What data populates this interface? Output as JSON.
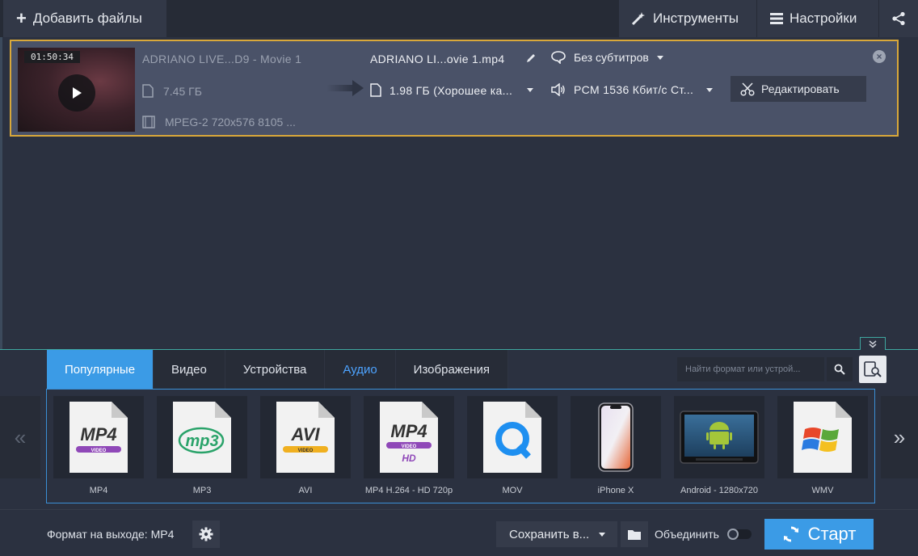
{
  "toolbar": {
    "add_files": "Добавить файлы",
    "tools": "Инструменты",
    "settings": "Настройки"
  },
  "file": {
    "duration": "01:50:34",
    "source_name": "ADRIANO LIVE...D9 - Movie 1",
    "source_size": "7.45 ГБ",
    "source_format": "MPEG-2 720x576 8105 ...",
    "output_name": "ADRIANO LI...ovie 1.mp4",
    "output_size": "1.98 ГБ (Хорошее ка...",
    "subtitles": "Без субтитров",
    "audio": "PCM 1536 Кбит/с Ст...",
    "edit": "Редактировать"
  },
  "tabs": [
    {
      "label": "Популярные",
      "active": true
    },
    {
      "label": "Видео"
    },
    {
      "label": "Устройства"
    },
    {
      "label": "Аудио"
    },
    {
      "label": "Изображения"
    }
  ],
  "search": {
    "placeholder": "Найти формат или устрой..."
  },
  "formats": [
    {
      "label": "MP4",
      "icon": "mp4-icon"
    },
    {
      "label": "MP3",
      "icon": "mp3-icon"
    },
    {
      "label": "AVI",
      "icon": "avi-icon"
    },
    {
      "label": "MP4 H.264 - HD 720p",
      "icon": "mp4-hd-icon"
    },
    {
      "label": "MOV",
      "icon": "mov-icon"
    },
    {
      "label": "iPhone X",
      "icon": "iphone-icon"
    },
    {
      "label": "Android - 1280x720",
      "icon": "android-icon"
    },
    {
      "label": "WMV",
      "icon": "wmv-icon"
    }
  ],
  "icon_text": {
    "mp4": "MP4",
    "video": "VIDEO",
    "mp3": "mp3",
    "avi": "AVI",
    "hd": "HD"
  },
  "bottom": {
    "output_format": "Формат на выходе: MP4",
    "save_to": "Сохранить в...",
    "merge": "Объединить",
    "start": "Старт"
  },
  "colors": {
    "accent": "#3b9be6",
    "highlight_border": "#d9a83a"
  }
}
